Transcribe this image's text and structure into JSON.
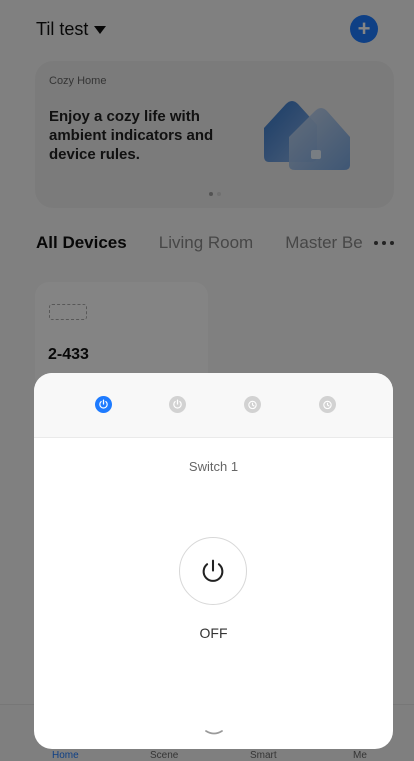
{
  "app": {
    "home_name": "Til test",
    "add_icon": "plus-icon"
  },
  "banner": {
    "title": "Cozy Home",
    "text": "Enjoy a cozy life with ambient indicators and device rules."
  },
  "tabs": [
    {
      "label": "All Devices"
    },
    {
      "label": "Living Room"
    },
    {
      "label": "Master Be"
    }
  ],
  "device": {
    "name": "2-433"
  },
  "sheet": {
    "switch_title": "Switch 1",
    "power_state": "OFF",
    "tabs": [
      {
        "icon": "power-icon"
      },
      {
        "icon": "power-icon"
      },
      {
        "icon": "timer-icon"
      },
      {
        "icon": "timer-icon"
      }
    ]
  },
  "bottom_nav": [
    {
      "label": "Home"
    },
    {
      "label": "Scene"
    },
    {
      "label": "Smart"
    },
    {
      "label": "Me"
    }
  ],
  "colors": {
    "accent": "#1e7bff",
    "overlay": "rgba(0,0,0,0.48)"
  }
}
